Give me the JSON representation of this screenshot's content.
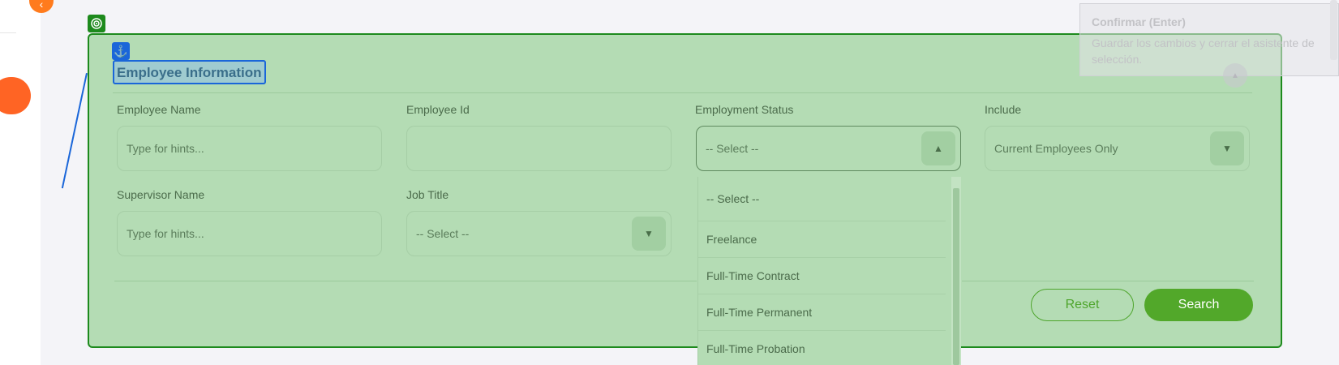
{
  "form": {
    "title": "Employee Information",
    "fields": {
      "employee_name": {
        "label": "Employee Name",
        "placeholder": "Type for hints..."
      },
      "employee_id": {
        "label": "Employee Id",
        "value": ""
      },
      "employment_status": {
        "label": "Employment Status",
        "value": "-- Select --"
      },
      "include": {
        "label": "Include",
        "value": "Current Employees Only"
      },
      "supervisor_name": {
        "label": "Supervisor Name",
        "placeholder": "Type for hints..."
      },
      "job_title": {
        "label": "Job Title",
        "value": "-- Select --"
      }
    },
    "employment_status_options": [
      "-- Select --",
      "Freelance",
      "Full-Time Contract",
      "Full-Time Permanent",
      "Full-Time Probation"
    ],
    "buttons": {
      "reset": "Reset",
      "search": "Search"
    }
  },
  "tooltip": {
    "title": "Confirmar (Enter)",
    "body_line1": "Guardar los cambios y cerrar el asistente de",
    "body_line2": "selección."
  },
  "icons": {
    "collapse": "chevron-left-icon",
    "target": "target-icon",
    "anchor": "anchor-icon",
    "caret_up": "caret-up-icon",
    "caret_down": "caret-down-icon"
  },
  "colors": {
    "accent_orange": "#ff6424",
    "highlight_green": "#1d8a1d",
    "highlight_blue": "#1a66d9",
    "button_green": "#52a82a"
  }
}
